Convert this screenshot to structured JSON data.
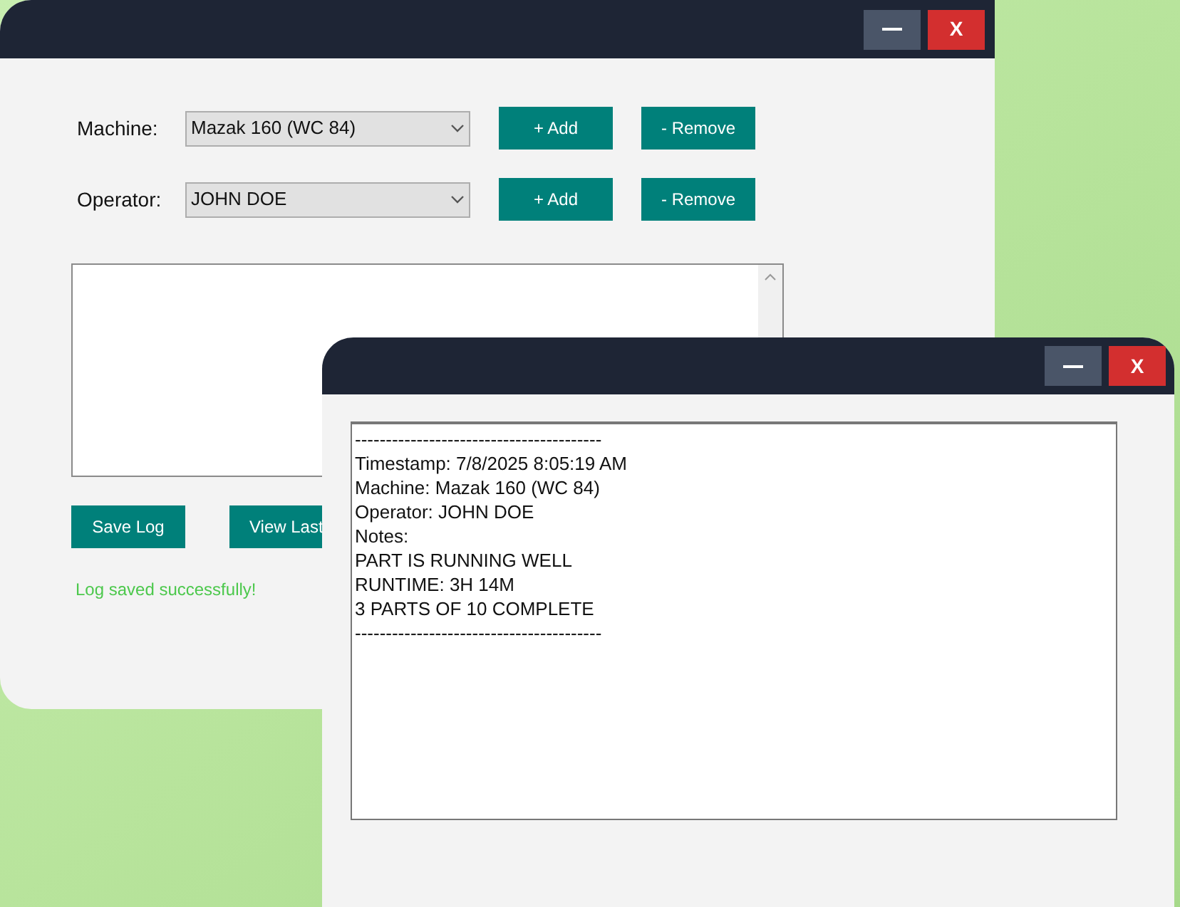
{
  "main_window": {
    "title_buttons": [
      {
        "kind": "minimize"
      },
      {
        "kind": "close",
        "label": "X"
      }
    ],
    "rows": [
      {
        "label": "Machine:",
        "value": "Mazak 160 (WC 84)",
        "add": "+ Add",
        "remove": "- Remove"
      },
      {
        "label": "Operator:",
        "value": "JOHN DOE",
        "add": "+ Add",
        "remove": "- Remove"
      }
    ],
    "buttons": [
      "Save Log",
      "View Last"
    ],
    "status": "Log saved successfully!"
  },
  "log_window": {
    "title_buttons": [
      {
        "kind": "minimize"
      },
      {
        "kind": "close",
        "label": "X"
      }
    ],
    "lines": [
      "----------------------------------------",
      "Timestamp: 7/8/2025 8:05:19 AM",
      "Machine: Mazak 160 (WC 84)",
      "Operator: JOHN DOE",
      "Notes:",
      "PART IS RUNNING WELL",
      "RUNTIME: 3H 14M",
      "3 PARTS OF 10 COMPLETE",
      "----------------------------------------"
    ]
  }
}
